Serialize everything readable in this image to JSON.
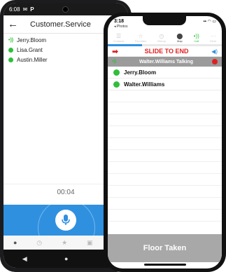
{
  "android": {
    "status_time": "6:08",
    "header_title": "Customer.Service",
    "back_icon": "arrow-left-icon",
    "members": [
      {
        "name": "Jerry.Bloom",
        "state": "talking"
      },
      {
        "name": "Lisa.Grant",
        "state": "online"
      },
      {
        "name": "Austin.Miller",
        "state": "online"
      }
    ],
    "timer": "00:04",
    "ptt_icon": "microphone-icon",
    "nav": [
      "◀",
      "●",
      "■"
    ]
  },
  "iphone": {
    "status_time": "3:18",
    "back_label": "◂ Photos",
    "tabs": [
      {
        "label": "Contacts",
        "icon": "contacts-icon"
      },
      {
        "label": "Favorites",
        "icon": "star-icon"
      },
      {
        "label": "History",
        "icon": "history-icon"
      },
      {
        "label": "Map",
        "icon": "map-pin-icon"
      },
      {
        "label": "Call",
        "icon": "call-icon"
      },
      {
        "label": "More",
        "icon": "more-icon"
      }
    ],
    "progress": 0.3,
    "slide_label": "SLIDE TO END",
    "talking_label": "Walter.Williams Talking",
    "members": [
      "Jerry.Bloom",
      "Walter.Williams"
    ],
    "floor_button": "Floor Taken"
  },
  "colors": {
    "accent_blue": "#2f90e0",
    "online_green": "#2fbf3a",
    "alert_red": "#e02020",
    "floor_gray": "#a8a8a8"
  }
}
